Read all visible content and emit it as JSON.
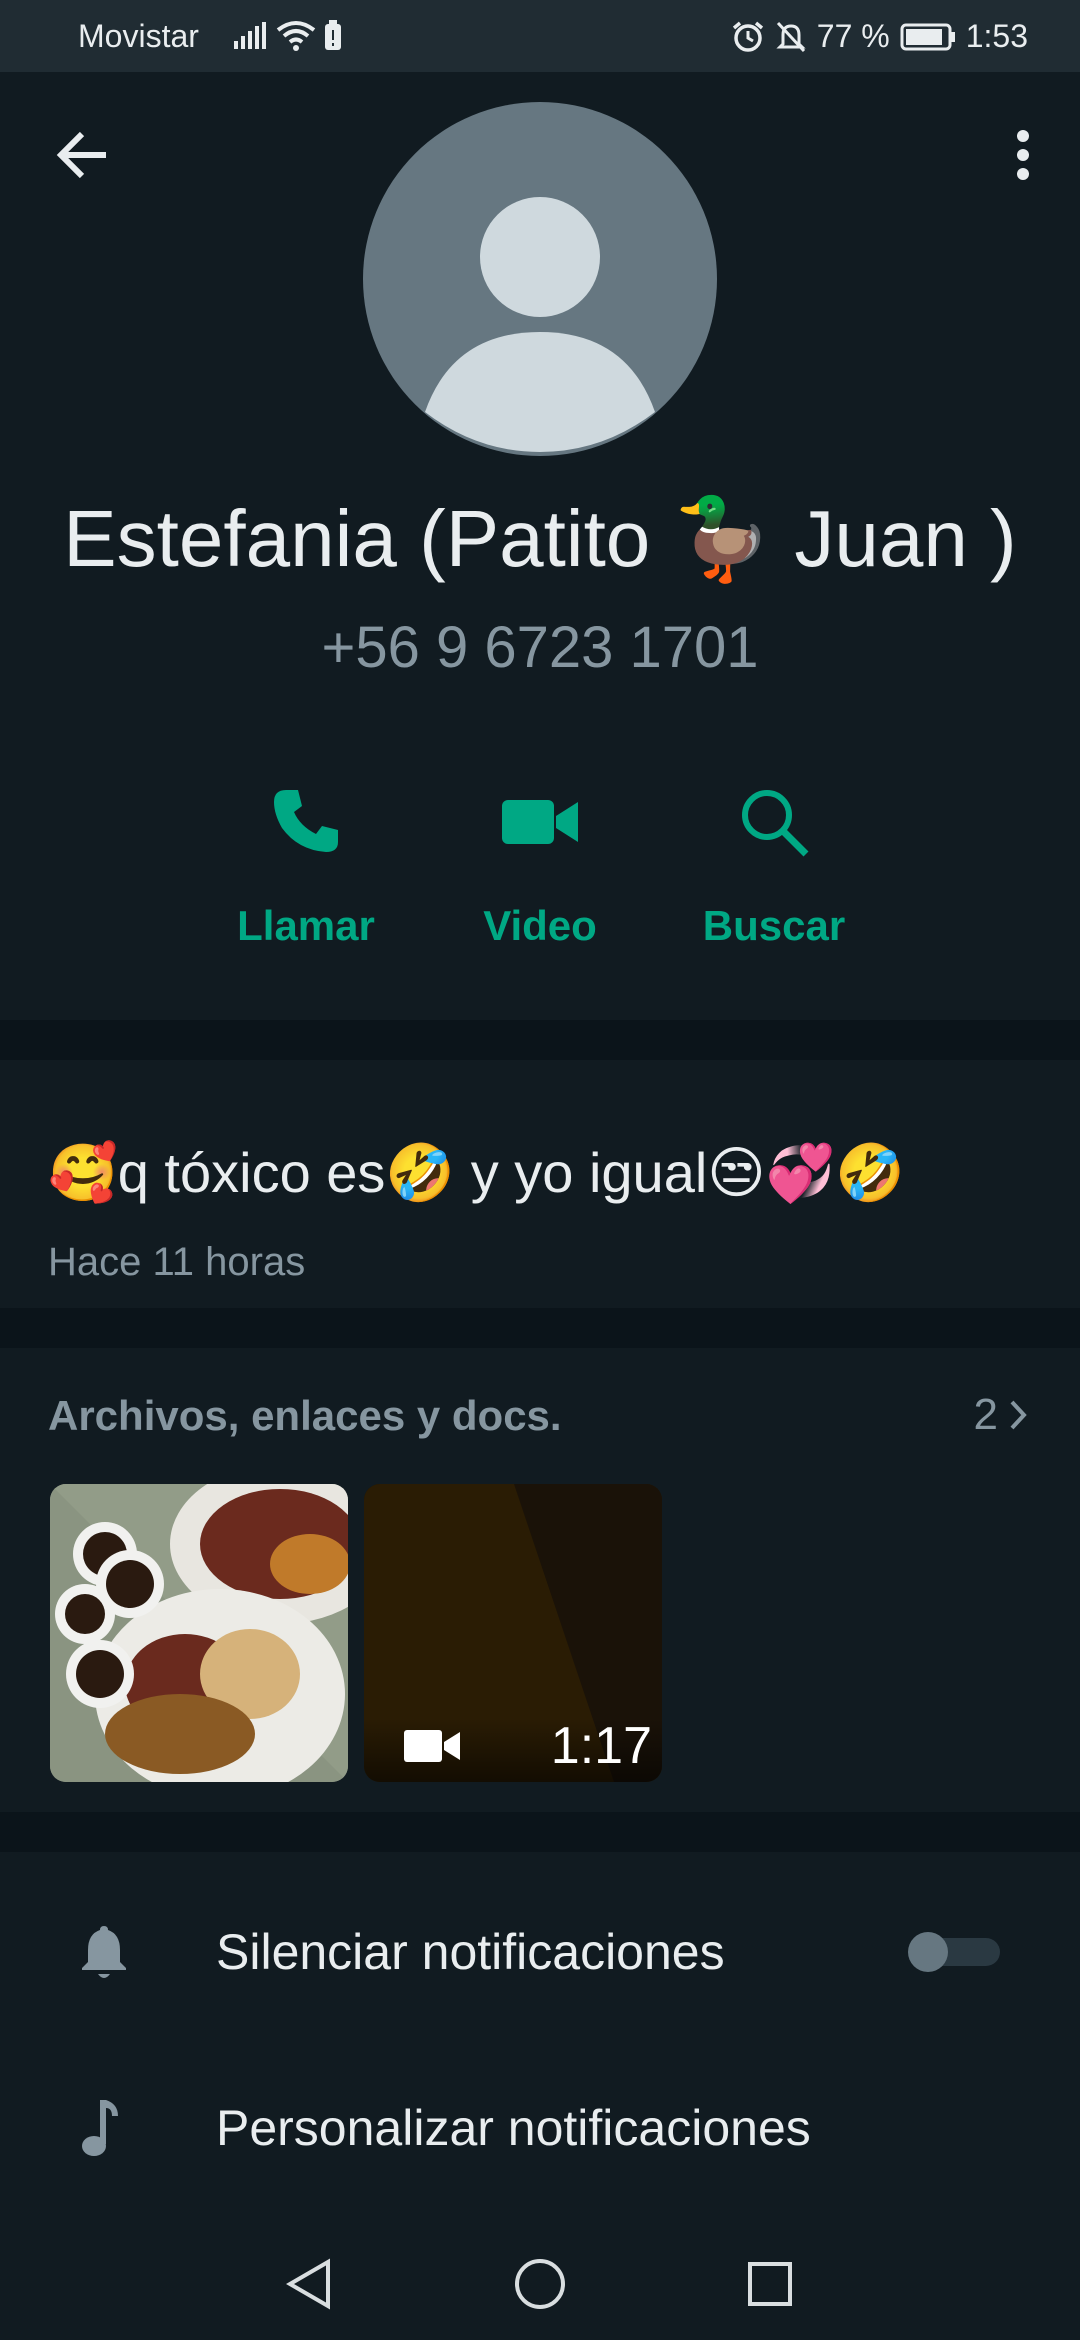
{
  "status_bar": {
    "carrier": "Movistar",
    "battery": "77 %",
    "time": "1:53",
    "icons": [
      "signal-icon",
      "wifi-icon",
      "battery-saver-icon",
      "alarm-icon",
      "notifications-off-icon",
      "battery-icon"
    ]
  },
  "header": {
    "back_icon": "arrow-back-icon",
    "menu_icon": "more-vert-icon",
    "avatar_icon": "default-avatar-icon",
    "name": "Estefania (Patito 🦆 Juan )",
    "phone": "+56 9 6723 1701"
  },
  "actions": [
    {
      "label": "Llamar",
      "icon": "phone-icon"
    },
    {
      "label": "Video",
      "icon": "videocam-icon"
    },
    {
      "label": "Buscar",
      "icon": "search-icon"
    }
  ],
  "about": {
    "text": "🥰q tóxico es🤣 y  yo igual😒💞🤣",
    "time": "Hace 11 horas"
  },
  "media": {
    "title": "Archivos, enlaces y docs.",
    "count": "2",
    "items": [
      {
        "type": "image",
        "description_icon": "photo-thumbnail"
      },
      {
        "type": "video",
        "duration": "1:17",
        "icon": "videocam-icon"
      }
    ]
  },
  "settings": [
    {
      "label": "Silenciar notificaciones",
      "icon": "bell-icon",
      "toggle": false
    },
    {
      "label": "Personalizar notificaciones",
      "icon": "music-note-icon"
    }
  ],
  "navbar": {
    "icons": [
      "back-triangle-icon",
      "home-circle-icon",
      "recents-square-icon"
    ]
  },
  "colors": {
    "background": "#111b21",
    "accent": "#00a884",
    "secondary_text": "#8696a0",
    "divider": "#0b141a"
  }
}
